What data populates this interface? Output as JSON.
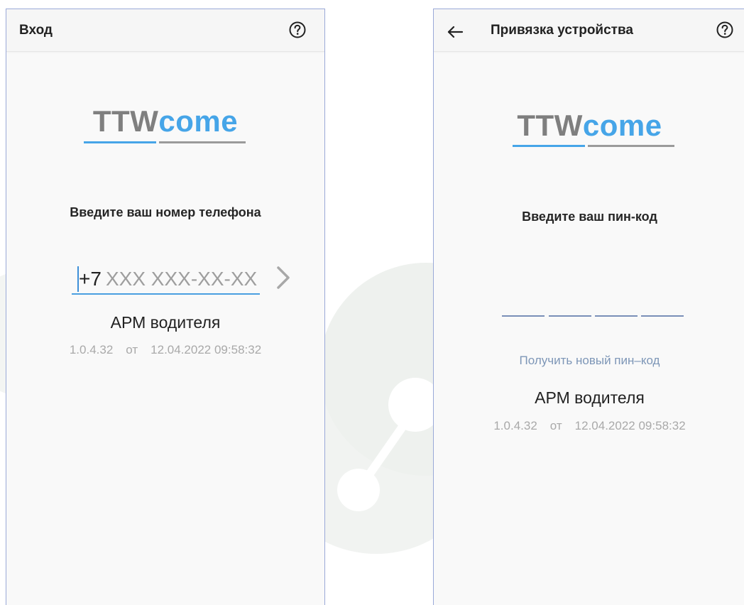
{
  "login_screen": {
    "title": "Вход",
    "logo": {
      "part_a": "TTW",
      "part_b": "come"
    },
    "prompt": "Введите ваш номер телефона",
    "phone": {
      "prefix": "+7",
      "value": "",
      "placeholder": "XXX XXX-XX-XX"
    },
    "app_name": "АРМ водителя",
    "version": {
      "number": "1.0.4.32",
      "separator": "от",
      "date": "12.04.2022 09:58:32"
    }
  },
  "bind_screen": {
    "title": "Привязка устройства",
    "logo": {
      "part_a": "TTW",
      "part_b": "come"
    },
    "prompt": "Введите ваш пин-код",
    "pin": [
      "",
      "",
      "",
      ""
    ],
    "new_pin_link": "Получить новый пин–код",
    "app_name": "АРМ водителя",
    "version": {
      "number": "1.0.4.32",
      "separator": "от",
      "date": "12.04.2022 09:58:32"
    }
  },
  "colors": {
    "accent_blue": "#46a5e8",
    "logo_gray": "#7f7f7f",
    "link_blue": "#7d96b7",
    "muted_text": "#a9a9a9"
  },
  "icons": {
    "help": "help-circle-icon",
    "back": "arrow-left-icon",
    "next": "chevron-right-icon"
  }
}
